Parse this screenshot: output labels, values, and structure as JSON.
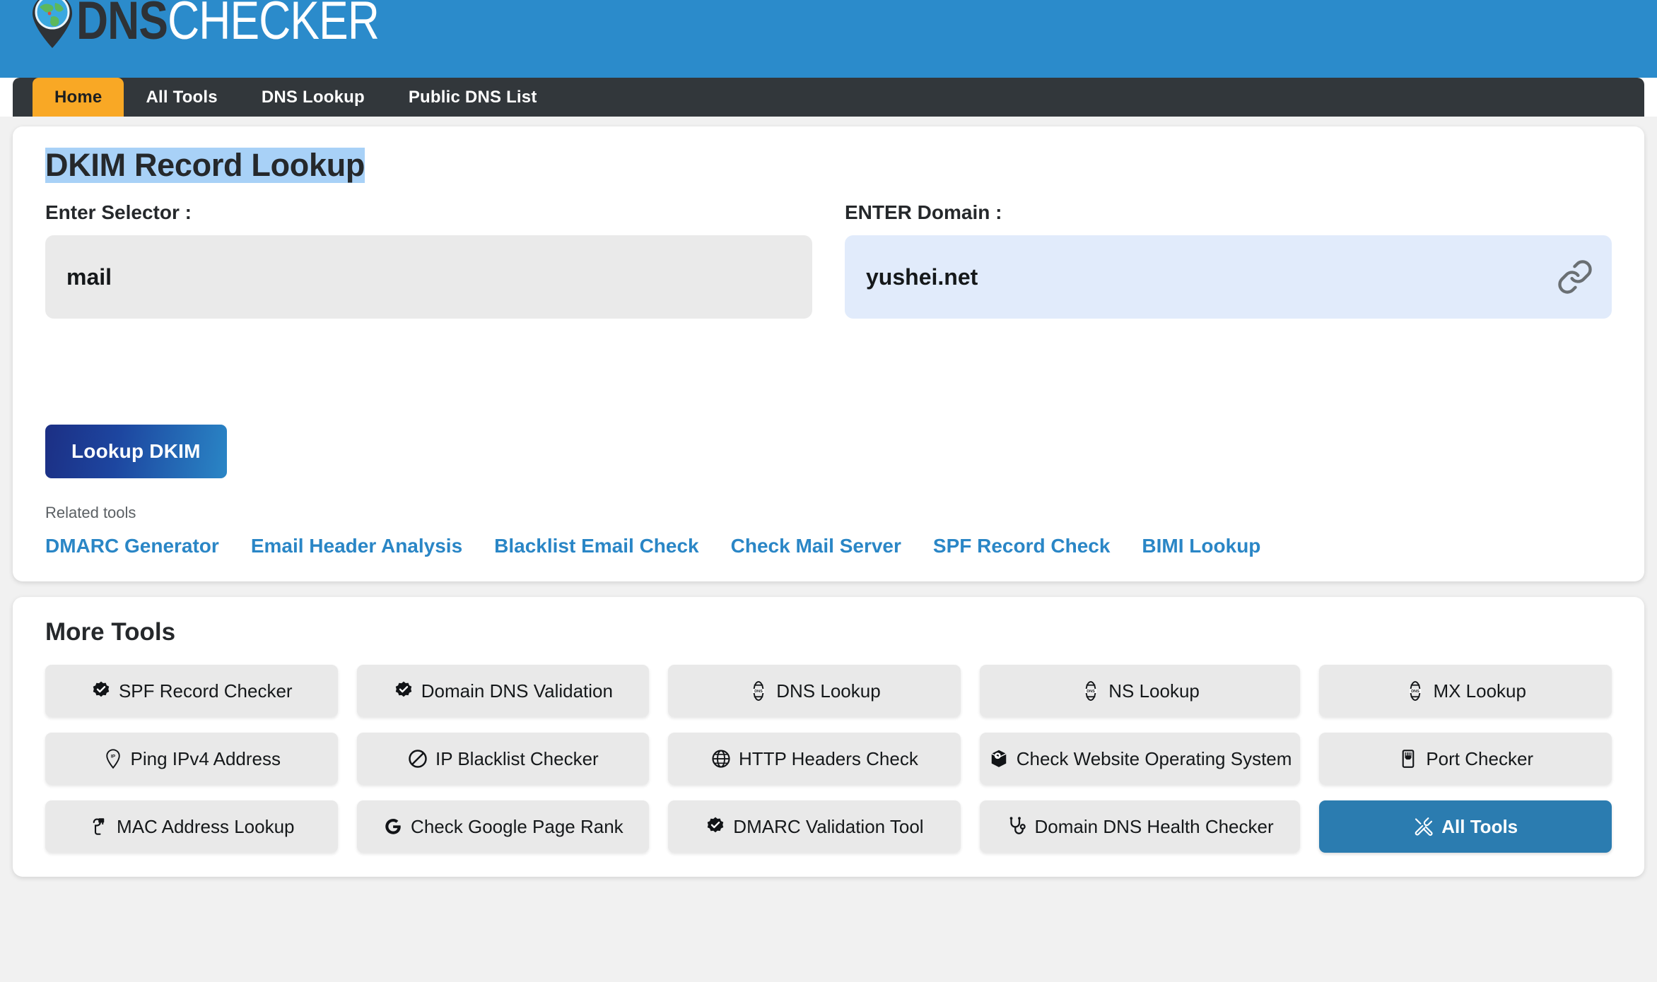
{
  "header": {
    "logo_dns": "DNS",
    "logo_checker": "CHECKER",
    "logo_icon": "globe-map-pin-icon",
    "brand_blue": "#2b8bcb"
  },
  "nav": {
    "items": [
      {
        "label": "Home",
        "active": true
      },
      {
        "label": "All Tools",
        "active": false
      },
      {
        "label": "DNS Lookup",
        "active": false
      },
      {
        "label": "Public DNS List",
        "active": false
      }
    ],
    "bar_color": "#32373b",
    "active_color": "#f9a825"
  },
  "tool": {
    "title": "DKIM Record Lookup",
    "title_highlight_color": "#a8d1f7",
    "selector_label": "Enter Selector :",
    "selector_value": "mail",
    "selector_placeholder": "Enter Selector",
    "domain_label": "ENTER Domain :",
    "domain_value": "yushei.net",
    "domain_placeholder": "Enter Domain",
    "domain_icon": "link-icon",
    "submit_label": "Lookup DKIM",
    "related_label": "Related tools",
    "related_links": [
      "DMARC Generator",
      "Email Header Analysis",
      "Blacklist Email Check",
      "Check Mail Server",
      "SPF Record Check",
      "BIMI Lookup"
    ],
    "link_color": "#2a86c6"
  },
  "more_tools": {
    "title": "More Tools",
    "items": [
      {
        "label": "SPF Record Checker",
        "icon": "badge-check-icon",
        "primary": false
      },
      {
        "label": "Domain DNS Validation",
        "icon": "badge-check-icon",
        "primary": false
      },
      {
        "label": "DNS Lookup",
        "icon": "dns-globe-icon",
        "primary": false
      },
      {
        "label": "NS Lookup",
        "icon": "dns-globe-icon",
        "primary": false
      },
      {
        "label": "MX Lookup",
        "icon": "dns-globe-icon",
        "primary": false
      },
      {
        "label": "Ping IPv4 Address",
        "icon": "ip-map-pin-icon",
        "primary": false
      },
      {
        "label": "IP Blacklist Checker",
        "icon": "prohibited-icon",
        "primary": false
      },
      {
        "label": "HTTP Headers Check",
        "icon": "globe-icon",
        "primary": false
      },
      {
        "label": "Check Website Operating System",
        "icon": "server-box-icon",
        "primary": false
      },
      {
        "label": "Port Checker",
        "icon": "ethernet-port-icon",
        "primary": false
      },
      {
        "label": "MAC Address Lookup",
        "icon": "network-plug-icon",
        "primary": false
      },
      {
        "label": "Check Google Page Rank",
        "icon": "google-g-icon",
        "primary": false
      },
      {
        "label": "DMARC Validation Tool",
        "icon": "badge-check-icon",
        "primary": false
      },
      {
        "label": "Domain DNS Health Checker",
        "icon": "stethoscope-icon",
        "primary": false
      },
      {
        "label": "All Tools",
        "icon": "tools-icon",
        "primary": true
      }
    ],
    "primary_color": "#2b7cb0"
  }
}
